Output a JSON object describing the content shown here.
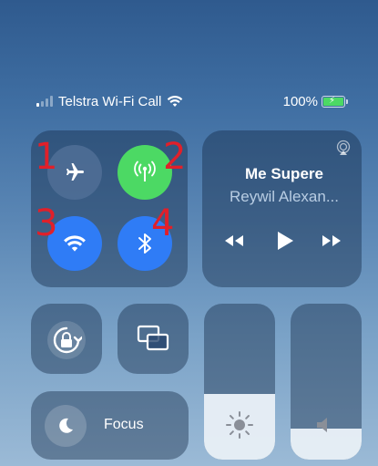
{
  "status_bar": {
    "carrier": "Telstra Wi-Fi Call",
    "battery_percent": "100%",
    "signal_bars_filled": 1,
    "signal_bars_total": 4,
    "charging": true,
    "battery_color": "#4cd964"
  },
  "connectivity": {
    "airplane_mode": {
      "icon": "airplane-icon",
      "active": false
    },
    "cellular_data": {
      "icon": "cellular-antenna-icon",
      "active": true,
      "color": "#4cd964"
    },
    "wifi": {
      "icon": "wifi-icon",
      "active": true,
      "color": "#2f7cf6"
    },
    "bluetooth": {
      "icon": "bluetooth-icon",
      "active": true,
      "color": "#2f7cf6"
    }
  },
  "annotations": [
    "1",
    "2",
    "3",
    "4"
  ],
  "annotation_color": "#e0202a",
  "now_playing": {
    "title": "Me Supere",
    "artist": "Reywil Alexan..."
  },
  "focus": {
    "label": "Focus"
  },
  "brightness_level": 0.42,
  "volume_level": 0.2
}
